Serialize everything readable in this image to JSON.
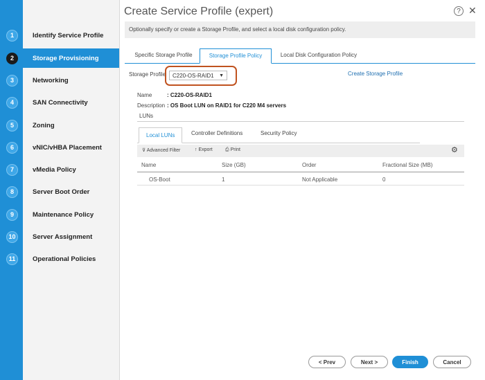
{
  "window": {
    "title": "Create Service Profile (expert)",
    "help_label": "?",
    "close_label": "✕",
    "info_text": "Optionally specify or create a Storage Profile, and select a local disk configuration policy."
  },
  "nav": {
    "items": [
      {
        "num": "1",
        "label": "Identify Service Profile"
      },
      {
        "num": "2",
        "label": "Storage Provisioning"
      },
      {
        "num": "3",
        "label": "Networking"
      },
      {
        "num": "4",
        "label": "SAN Connectivity"
      },
      {
        "num": "5",
        "label": "Zoning"
      },
      {
        "num": "6",
        "label": "vNIC/vHBA Placement"
      },
      {
        "num": "7",
        "label": "vMedia Policy"
      },
      {
        "num": "8",
        "label": "Server Boot Order"
      },
      {
        "num": "9",
        "label": "Maintenance Policy"
      },
      {
        "num": "10",
        "label": "Server Assignment"
      },
      {
        "num": "11",
        "label": "Operational Policies"
      }
    ],
    "active_index": 1
  },
  "tabs": [
    {
      "label": "Specific Storage Profile"
    },
    {
      "label": "Storage Profile Policy"
    },
    {
      "label": "Local Disk Configuration Policy"
    }
  ],
  "storage_profile": {
    "label": "Storage Profile",
    "selected": "C220-OS-RAID1",
    "caret": "▼",
    "create_link": "Create Storage Profile"
  },
  "details": {
    "name_key": "Name",
    "name_value": ": C220-OS-RAID1",
    "desc_key": "Description",
    "desc_value": ": OS Boot LUN on RAID1 for C220 M4 servers",
    "luns_heading": "LUNs"
  },
  "subtabs": [
    {
      "label": "Local LUNs"
    },
    {
      "label": "Controller Definitions"
    },
    {
      "label": "Security Policy"
    }
  ],
  "toolbar": {
    "filter": "Advanced Filter",
    "export": "Export",
    "print": "Print",
    "filter_icon": "⊽",
    "export_icon": "↑",
    "print_icon": "⎙",
    "settings_icon": "⚙"
  },
  "table": {
    "columns": [
      "Name",
      "Size (GB)",
      "Order",
      "Fractional Size (MB)"
    ],
    "rows": [
      [
        "OS-Boot",
        "1",
        "Not Applicable",
        "0"
      ]
    ]
  },
  "footer": {
    "prev": "< Prev",
    "next": "Next >",
    "finish": "Finish",
    "cancel": "Cancel"
  },
  "colors": {
    "accent": "#1f8fd6",
    "highlight": "#c0521f"
  }
}
